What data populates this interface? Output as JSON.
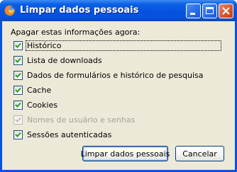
{
  "window": {
    "title": "Limpar dados pessoais"
  },
  "dialog": {
    "heading": "Apagar estas informações agora:",
    "options": [
      {
        "label": "Histórico",
        "checked": true,
        "enabled": true
      },
      {
        "label": "Lista de downloads",
        "checked": true,
        "enabled": true
      },
      {
        "label": "Dados de formulários e histórico de pesquisa",
        "checked": true,
        "enabled": true
      },
      {
        "label": "Cache",
        "checked": true,
        "enabled": true
      },
      {
        "label": "Cookies",
        "checked": true,
        "enabled": true
      },
      {
        "label": "Nomes de usuário e senhas",
        "checked": true,
        "enabled": false
      },
      {
        "label": "Sessões autenticadas",
        "checked": true,
        "enabled": true
      }
    ],
    "buttons": {
      "clear_label": "Limpar dados pessoais",
      "cancel_label": "Cancelar"
    }
  },
  "icons": {
    "app": "firefox-icon",
    "minimize": "minimize-icon",
    "maximize": "maximize-icon",
    "close": "close-icon",
    "check": "checkmark-icon"
  },
  "colors": {
    "titlebar": "#0553dc",
    "dialog_bg": "#ece9d8",
    "check": "#21a121",
    "close_button": "#d9572c",
    "disabled_text": "#a5a29a"
  }
}
